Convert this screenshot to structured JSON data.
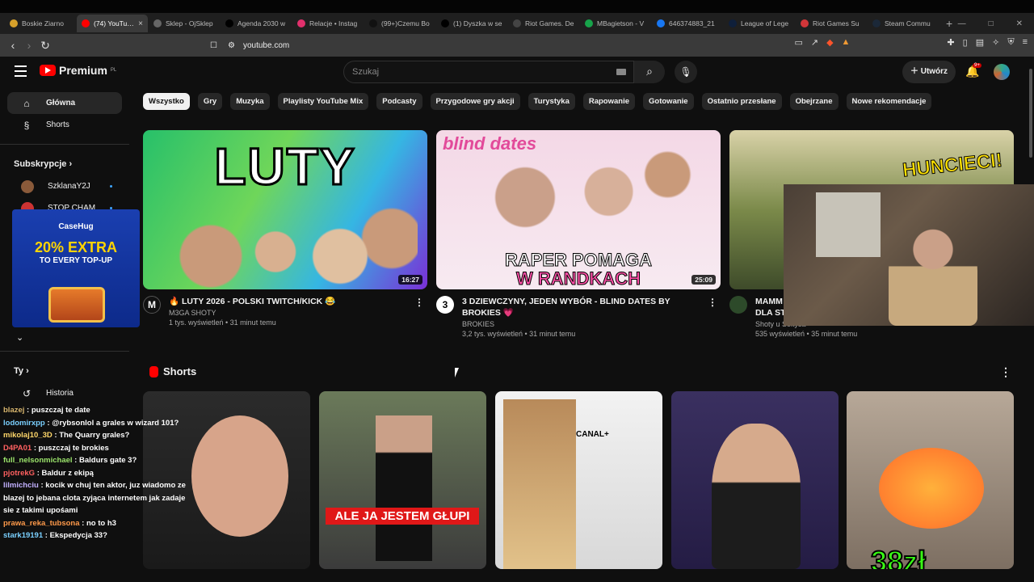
{
  "browser": {
    "tabs": [
      {
        "label": "Boskie Ziarno",
        "color": "#d6a02a"
      },
      {
        "label": "(74) YouTube",
        "color": "#ff0000"
      },
      {
        "label": "Sklep - OjSklep",
        "color": "#666666"
      },
      {
        "label": "Agenda 2030 w",
        "color": "#000000"
      },
      {
        "label": "Relacje • Instag",
        "color": "#e1306c"
      },
      {
        "label": "(99+)Czemu Bo",
        "color": "#111111"
      },
      {
        "label": "(1) Dyszka w se",
        "color": "#000000"
      },
      {
        "label": "Riot Games. De",
        "color": "#444444"
      },
      {
        "label": "MBagietson - V",
        "color": "#17a34a"
      },
      {
        "label": "646374883_21",
        "color": "#1877f2"
      },
      {
        "label": "League of Lege",
        "color": "#0f1f3a"
      },
      {
        "label": "Riot Games Su",
        "color": "#d13639"
      },
      {
        "label": "Steam Commu",
        "color": "#1b2838"
      }
    ],
    "url": "youtube.com",
    "window_controls": [
      "—",
      "□",
      "✕"
    ]
  },
  "header": {
    "logo": "Premium",
    "region": "PL",
    "search_placeholder": "Szukaj",
    "create_label": "Utwórz",
    "notification_count": "9+"
  },
  "sidebar": {
    "main": [
      {
        "label": "Główna",
        "icon": "home-icon"
      },
      {
        "label": "Shorts",
        "icon": "shorts-icon"
      }
    ],
    "subscriptions_title": "Subskrypcje",
    "subscriptions": [
      {
        "label": "SzklanaY2J",
        "color": "#8a5a3a"
      },
      {
        "label": "STOP CHAM",
        "color": "#c33"
      }
    ],
    "you_title": "Ty",
    "you": [
      {
        "label": "Historia",
        "icon": "history-icon"
      }
    ]
  },
  "promo": {
    "brand": "CaseHug",
    "headline": "20% EXTRA",
    "subline": "TO EVERY TOP-UP"
  },
  "chips": [
    "Wszystko",
    "Gry",
    "Muzyka",
    "Playlisty YouTube Mix",
    "Podcasty",
    "Przygodowe gry akcji",
    "Turystyka",
    "Rapowanie",
    "Gotowanie",
    "Ostatnio przesłane",
    "Obejrzane",
    "Nowe rekomendacje"
  ],
  "videos": [
    {
      "title": "🔥 LUTY 2026 - POLSKI TWITCH/KICK 😂",
      "channel": "M3GA SHOTY",
      "stats": "1 tys. wyświetleń • 31 minut temu",
      "duration": "16:27",
      "overlay": "LUTY",
      "avatar_letter": "M"
    },
    {
      "title": "3 DZIEWCZYNY, JEDEN WYBÓR - BLIND DATES BY BROKIES 💗",
      "channel": "BROKIES",
      "stats": "3,2 tys. wyświetleń • 31 minut temu",
      "duration": "25:09",
      "overlay_top": "blind dates",
      "overlay_1": "RAPER POMAGA",
      "overlay_2": "W RANDKACH",
      "avatar_letter": "3"
    },
    {
      "title": "MAMM",
      "title2": "DLA ST",
      "channel": "Shoty u Sołtysa",
      "stats": "535 wyświetleń • 35 minut temu",
      "overlay": "HUNCIECI!"
    }
  ],
  "shorts": {
    "title": "Shorts",
    "items": [
      {
        "overlay": ""
      },
      {
        "overlay": "ALE JA JESTEM GŁUPI"
      },
      {
        "overlay": "CANAL+"
      },
      {
        "overlay": ""
      },
      {
        "overlay": "38zł"
      }
    ]
  },
  "chat": [
    {
      "user": "blazej",
      "text": "puszczaj te date",
      "cls": "u1"
    },
    {
      "user": "lodomirxpp",
      "text": "@rybsonlol a grales w wizard 101?",
      "cls": "u2"
    },
    {
      "user": "mikolaj10_3D",
      "text": "The Quarry grales?",
      "cls": "u5"
    },
    {
      "user": "D4PA01",
      "text": "puszczaj te brokies",
      "cls": "u3"
    },
    {
      "user": "full_nelsonmichael",
      "text": "Baldurs gate 3?",
      "cls": "u4"
    },
    {
      "user": "pjotrekG",
      "text": "Baldur z ekipą",
      "cls": "u3"
    },
    {
      "user": "lilmichciu",
      "text": "kocik w chuj ten aktor, juz wiadomo ze blazej to jebana clota zyjąca internetem jak zadaje sie z takimi upośami",
      "cls": "u6"
    },
    {
      "user": "prawa_reka_tubsona",
      "text": "no to h3",
      "cls": "u7"
    },
    {
      "user": "stark19191",
      "text": "Ekspedycja 33?",
      "cls": "u2"
    }
  ]
}
